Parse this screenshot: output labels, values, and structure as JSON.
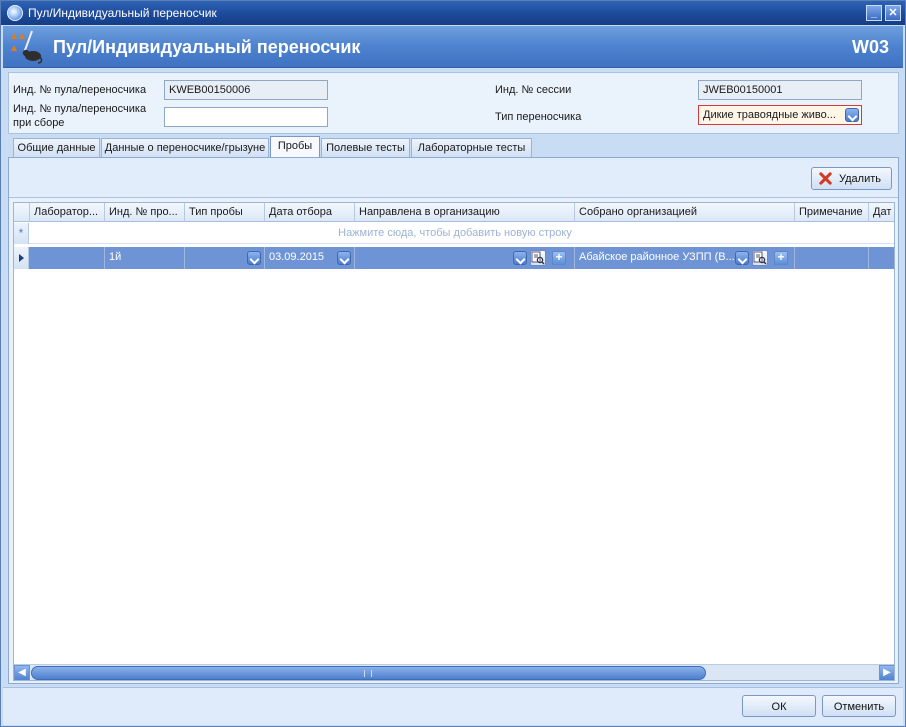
{
  "window": {
    "title": "Пул/Индивидуальный переносчик"
  },
  "banner": {
    "heading": "Пул/Индивидуальный переносчик",
    "code": "W03"
  },
  "form": {
    "pool_id_label": "Инд. № пула/переносчика",
    "pool_id_value": "KWEB00150006",
    "pool_id_collect_label": "Инд. № пула/переносчика при сборе",
    "pool_id_collect_value": "",
    "session_id_label": "Инд. № сессии",
    "session_id_value": "JWEB00150001",
    "vector_type_label": "Тип переносчика",
    "vector_type_value": "Дикие травоядные живо..."
  },
  "tabs": [
    {
      "label": "Общие данные",
      "active": false
    },
    {
      "label": "Данные о переносчике/грызуне",
      "active": false
    },
    {
      "label": "Пробы",
      "active": true
    },
    {
      "label": "Полевые тесты",
      "active": false
    },
    {
      "label": "Лабораторные тесты",
      "active": false
    }
  ],
  "toolbar": {
    "delete_label": "Удалить"
  },
  "grid": {
    "columns": [
      "Лаборатор...",
      "Инд. № про...",
      "Тип пробы",
      "Дата отбора",
      "Направлена в организацию",
      "Собрано организацией",
      "Примечание",
      "Дат"
    ],
    "new_row_hint": "Нажмите сюда, чтобы добавить новую строку",
    "new_row_marker": "*",
    "rows": [
      {
        "lab": "",
        "sample_id": "1й",
        "sample_type": "",
        "collection_date": "03.09.2015",
        "sent_to": "",
        "collected_by": "Абайское районное УЗПП (В...",
        "note": "",
        "date": ""
      }
    ]
  },
  "footer": {
    "ok_label": "ОК",
    "cancel_label": "Отменить"
  },
  "icons": {
    "app": "app-globe-icon",
    "logo": "vector-rodent-logo-icon",
    "delete": "red-x-icon",
    "dropdown": "chevron-down-icon",
    "search": "search-lookup-icon",
    "add": "plus-icon",
    "row_pointer": "row-pointer-icon"
  },
  "colors": {
    "titlebar": "#1d4a9a",
    "banner": "#4d82cf",
    "selected_row": "#6f94d6",
    "required_border": "#d23b3b",
    "hint_text": "#9cb2d3"
  }
}
